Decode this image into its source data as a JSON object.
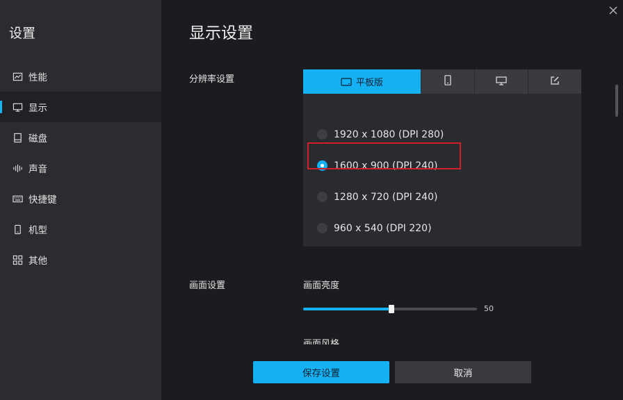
{
  "sidebar": {
    "title": "设置",
    "items": [
      {
        "label": "性能",
        "icon": "chart-icon"
      },
      {
        "label": "显示",
        "icon": "monitor-icon",
        "active": true
      },
      {
        "label": "磁盘",
        "icon": "disk-icon"
      },
      {
        "label": "声音",
        "icon": "sound-icon"
      },
      {
        "label": "快捷键",
        "icon": "keyboard-icon"
      },
      {
        "label": "机型",
        "icon": "phone-icon"
      },
      {
        "label": "其他",
        "icon": "grid-icon"
      }
    ]
  },
  "main": {
    "title": "显示设置",
    "resolution": {
      "label": "分辨率设置",
      "tabs": [
        {
          "label": "平板版",
          "icon": "tablet-icon",
          "active": true
        },
        {
          "label": "",
          "icon": "phone-icon"
        },
        {
          "label": "",
          "icon": "monitor-icon"
        },
        {
          "label": "",
          "icon": "edit-icon"
        }
      ],
      "options": [
        {
          "label": "1920 x 1080 (DPI 280)",
          "checked": false
        },
        {
          "label": "1600 x 900 (DPI 240)",
          "checked": true
        },
        {
          "label": "1280 x 720 (DPI 240)",
          "checked": false
        },
        {
          "label": "960 x 540 (DPI 220)",
          "checked": false
        }
      ]
    },
    "screen": {
      "label": "画面设置",
      "brightness_label": "画面亮度",
      "brightness_value": "50",
      "brightness_fraction": 0.5,
      "next_label": "画面风格"
    }
  },
  "footer": {
    "save_label": "保存设置",
    "cancel_label": "取消"
  },
  "colors": {
    "accent": "#14b1f5",
    "highlight": "#d21f2a"
  }
}
